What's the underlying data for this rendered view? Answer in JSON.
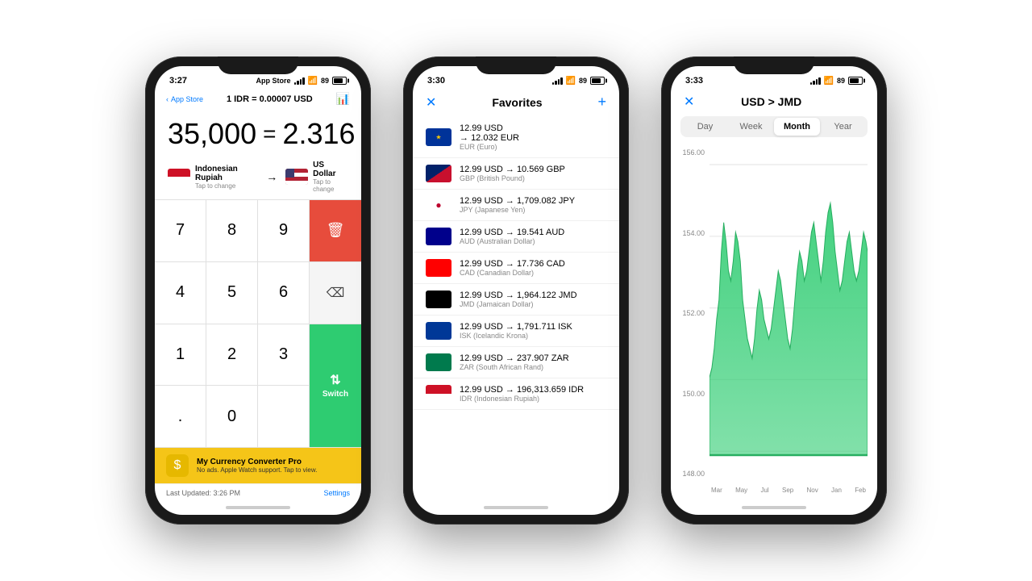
{
  "phones": [
    {
      "id": "phone1",
      "status": {
        "time": "3:27",
        "network": "App Store",
        "battery": "89"
      },
      "nav": {
        "back": "App Store",
        "title": "1 IDR = 0.00007 USD",
        "chart_icon": "📊"
      },
      "conversion": {
        "from": "35,000",
        "eq": "=",
        "to": "2.316"
      },
      "from_currency": {
        "name": "Indonesian Rupiah",
        "tap": "Tap to change"
      },
      "to_currency": {
        "name": "US Dollar",
        "tap": "Tap to change"
      },
      "keypad": [
        "7",
        "8",
        "9",
        "DEL",
        "4",
        "5",
        "6",
        "⌫",
        "1",
        "2",
        "3",
        "Switch",
        ".",
        "0",
        "",
        ""
      ],
      "ad": {
        "title": "My Currency Converter Pro",
        "subtitle": "No ads. Apple Watch support. Tap to view."
      },
      "footer": {
        "last_updated": "Last Updated: 3:26 PM",
        "settings": "Settings"
      }
    },
    {
      "id": "phone2",
      "status": {
        "time": "3:30",
        "battery": "89"
      },
      "nav": {
        "title": "Favorites"
      },
      "favorites": [
        {
          "from": "12.99 USD",
          "to": "12.032 EUR",
          "sub": "EUR (Euro)",
          "flag": "eu"
        },
        {
          "from": "12.99 USD",
          "to": "10.569 GBP",
          "sub": "GBP (British Pound)",
          "flag": "gb"
        },
        {
          "from": "12.99 USD",
          "to": "1,709.082 JPY",
          "sub": "JPY (Japanese Yen)",
          "flag": "jp"
        },
        {
          "from": "12.99 USD",
          "to": "19.541 AUD",
          "sub": "AUD (Australian Dollar)",
          "flag": "au"
        },
        {
          "from": "12.99 USD",
          "to": "17.736 CAD",
          "sub": "CAD (Canadian Dollar)",
          "flag": "ca"
        },
        {
          "from": "12.99 USD",
          "to": "1,964.122 JMD",
          "sub": "JMD (Jamaican Dollar)",
          "flag": "jm"
        },
        {
          "from": "12.99 USD",
          "to": "1,791.711 ISK",
          "sub": "ISK (Icelandic Krona)",
          "flag": "is"
        },
        {
          "from": "12.99 USD",
          "to": "237.907 ZAR",
          "sub": "ZAR (South African Rand)",
          "flag": "za"
        },
        {
          "from": "12.99 USD",
          "to": "196,313.659 IDR",
          "sub": "IDR (Indonesian Rupiah)",
          "flag": "id2"
        }
      ]
    },
    {
      "id": "phone3",
      "status": {
        "time": "3:33",
        "battery": "89"
      },
      "nav": {
        "title": "USD > JMD"
      },
      "tabs": [
        "Day",
        "Week",
        "Month",
        "Year"
      ],
      "active_tab": "Month",
      "y_axis": [
        "156.00",
        "154.00",
        "152.00",
        "150.00",
        "148.00"
      ],
      "x_axis": [
        "Mar",
        "May",
        "Jul",
        "Sep",
        "Nov",
        "Jan",
        "Feb"
      ],
      "chart_color": "#2ecc71"
    }
  ]
}
